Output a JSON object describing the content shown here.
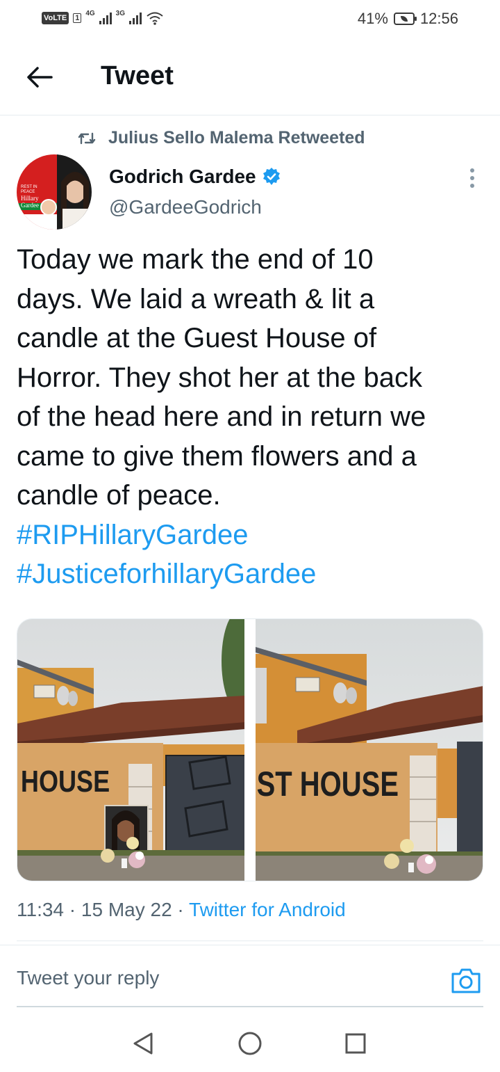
{
  "status_bar": {
    "volte": "VoLTE",
    "sim": "1",
    "net1": "4G",
    "net2": "3G",
    "battery": "41%",
    "time": "12:56"
  },
  "header": {
    "title": "Tweet",
    "back_icon": "back-arrow-icon"
  },
  "retweet": {
    "icon": "retweet-icon",
    "label": "Julius Sello Malema Retweeted"
  },
  "author": {
    "name": "Godrich Gardee",
    "handle": "@GardeeGodrich",
    "verified": true,
    "avatar_text": {
      "rest_in_peace": "REST IN PEACE",
      "name_line1": "Hillary",
      "name_line2": "Gardee"
    }
  },
  "tweet": {
    "text_lines": [
      "Today we mark the end of 10",
      "days. We laid a wreath & lit a",
      "candle at the Guest House of",
      "Horror. They shot her at the back",
      "of the head here and in return we",
      "came to give them flowers and a",
      "candle of peace."
    ],
    "hashtags": [
      "#RIPHillaryGardee",
      "#JusticeforhillaryGardee"
    ],
    "photos": [
      {
        "wall_text": "HOUSE"
      },
      {
        "wall_text": "ST HOUSE"
      }
    ],
    "time": "11:34",
    "date": "15 May 22",
    "separator": "·",
    "source": "Twitter for Android"
  },
  "reply": {
    "placeholder": "Tweet your reply",
    "camera_icon": "camera-icon"
  },
  "nav": {
    "back": "nav-back-icon",
    "home": "nav-home-icon",
    "recents": "nav-recents-icon"
  },
  "colors": {
    "link": "#1d9bf0",
    "secondary_text": "#536471",
    "primary_text": "#0f1419"
  }
}
